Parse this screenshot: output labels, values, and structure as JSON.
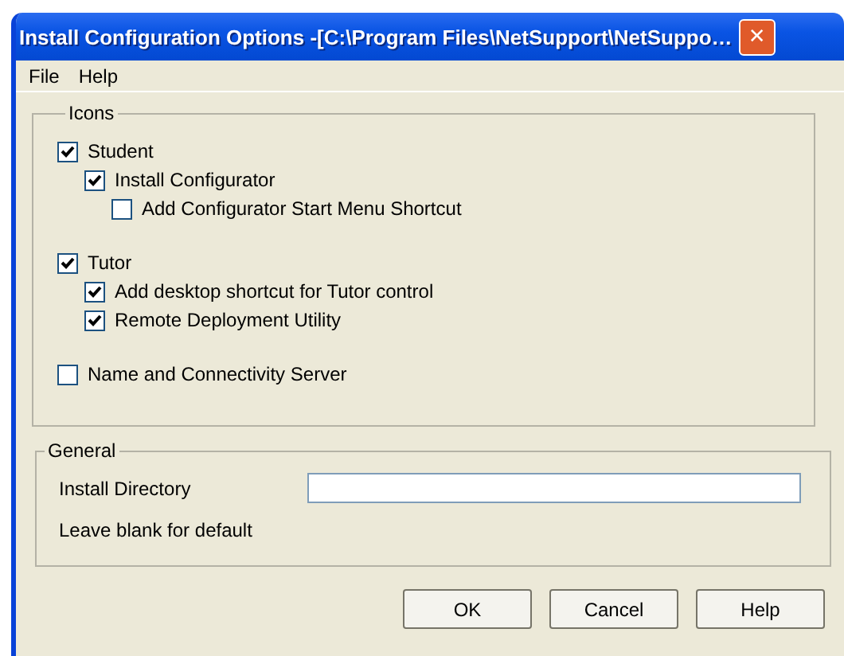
{
  "window": {
    "title": "Install Configuration Options -[C:\\Program Files\\NetSupport\\NetSuppo…",
    "close": "✕"
  },
  "menu": [
    "File",
    "Help"
  ],
  "icons_group": {
    "title": "Icons",
    "items": [
      {
        "label": "Student",
        "checked": true,
        "children": [
          {
            "label": "Install Configurator",
            "checked": true,
            "children": [
              {
                "label": "Add Configurator Start Menu Shortcut",
                "checked": false
              }
            ]
          }
        ]
      },
      {
        "label": "Tutor",
        "checked": true,
        "children": [
          {
            "label": "Add desktop shortcut for Tutor control",
            "checked": true
          },
          {
            "label": "Remote Deployment Utility",
            "checked": true
          }
        ]
      },
      {
        "label": "Name and Connectivity Server",
        "checked": false
      }
    ]
  },
  "general_group": {
    "title": "General",
    "install_directory_label": "Install Directory",
    "hint": "Leave blank for default"
  },
  "buttons": [
    "OK",
    "Cancel",
    "Help"
  ]
}
